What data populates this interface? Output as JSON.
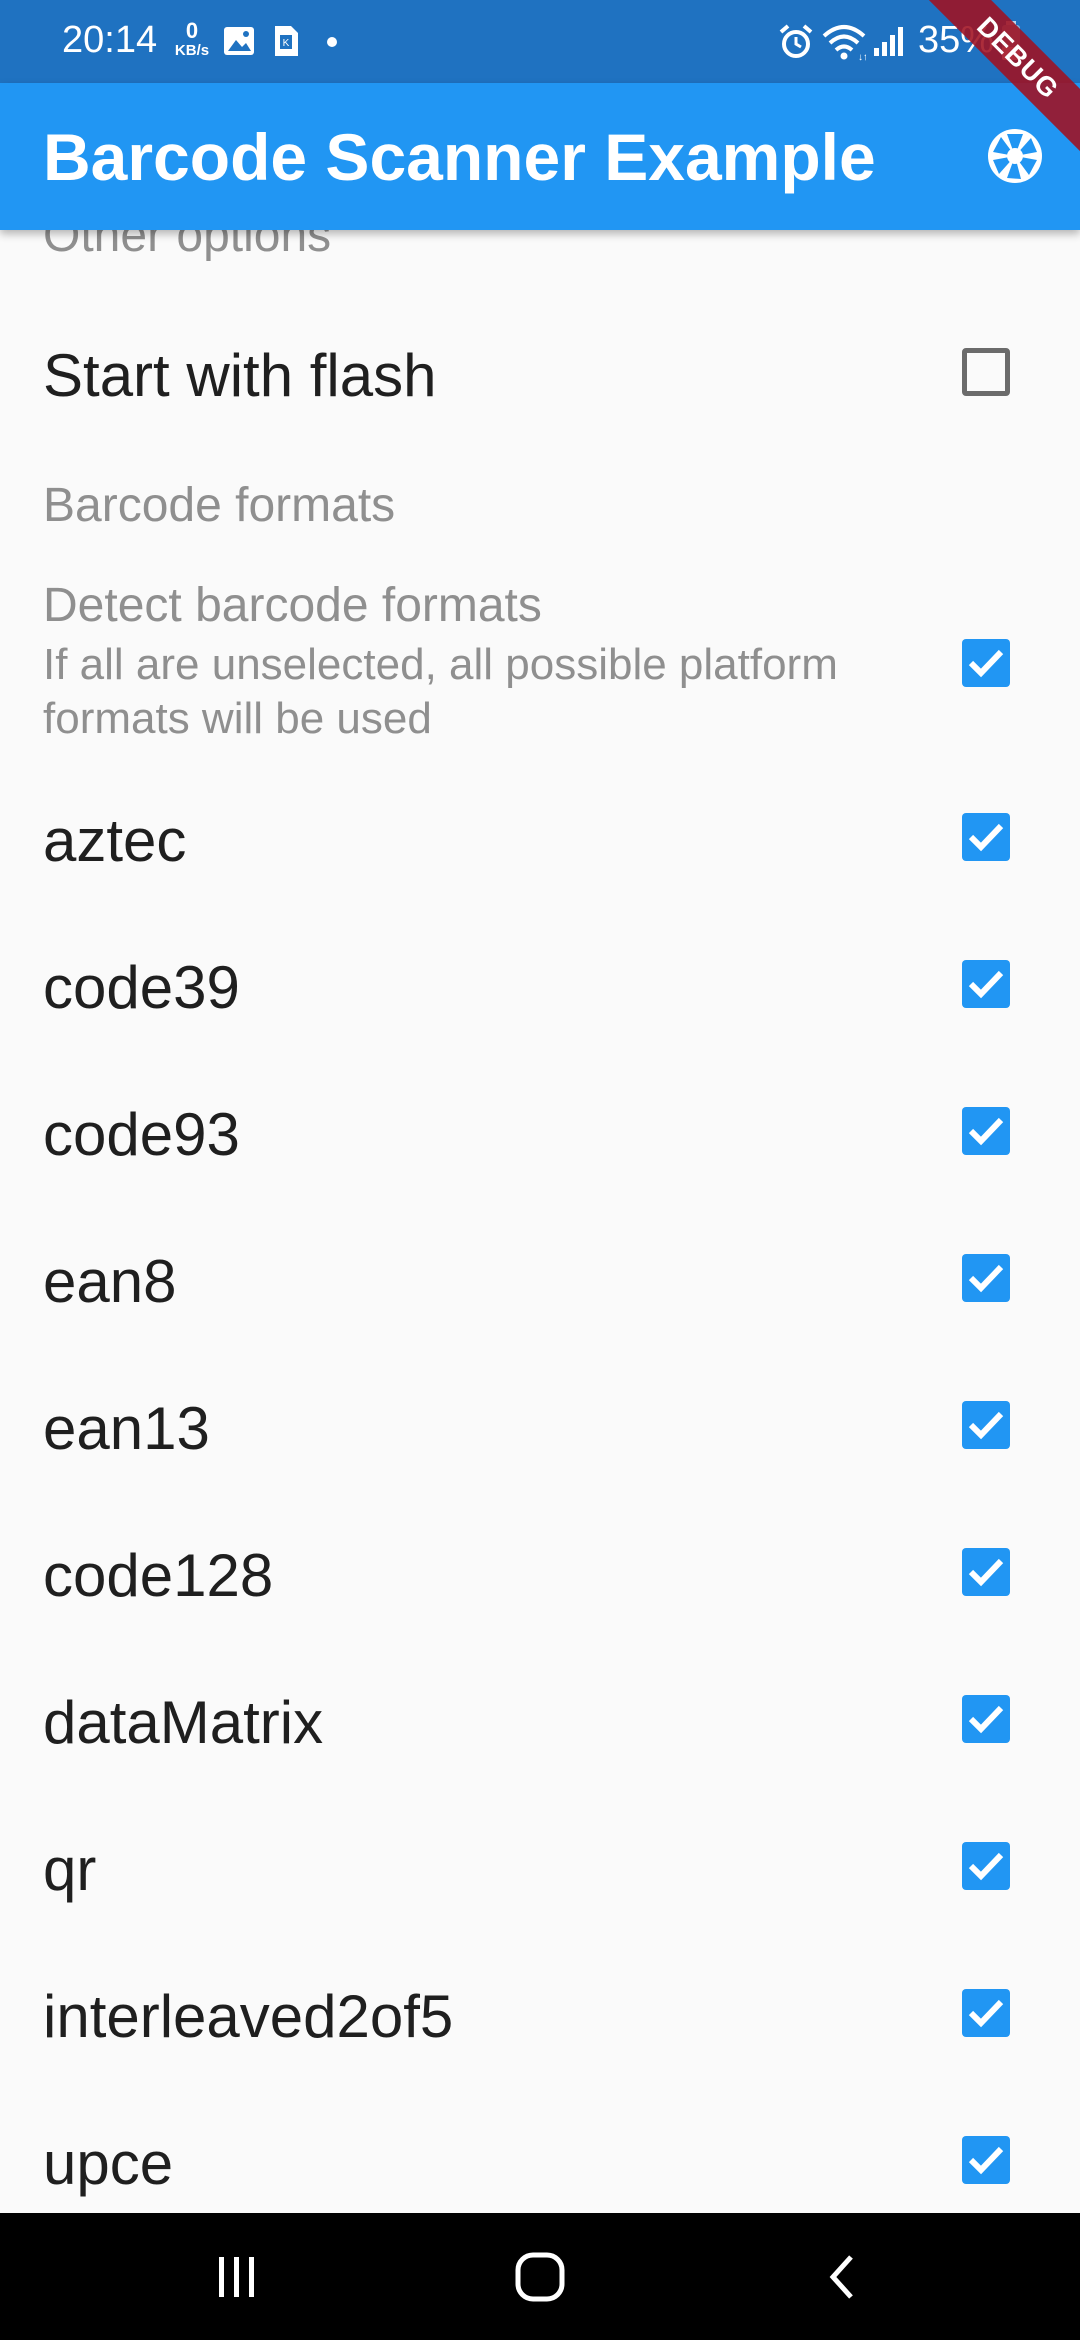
{
  "status_bar": {
    "time": "20:14",
    "net_speed_value": "0",
    "net_speed_unit": "KB/s",
    "battery_percent": "35%",
    "icons": [
      "image-icon",
      "sim-card-icon",
      "dot-icon",
      "alarm-icon",
      "wifi-icon",
      "signal-icon",
      "battery-icon"
    ]
  },
  "app_bar": {
    "title": "Barcode Scanner Example",
    "action_icon": "camera-shutter-icon",
    "background": "#2196f3"
  },
  "debug_banner": {
    "label": "DEBUG"
  },
  "settings": {
    "other_options_header": "Other options",
    "start_with_flash": {
      "label": "Start with flash",
      "checked": false
    },
    "barcode_formats_header": "Barcode formats",
    "detect_formats": {
      "title": "Detect barcode formats",
      "subtitle": "If all are unselected, all possible platform formats will be used",
      "checked": true
    },
    "formats": [
      {
        "label": "aztec",
        "checked": true
      },
      {
        "label": "code39",
        "checked": true
      },
      {
        "label": "code93",
        "checked": true
      },
      {
        "label": "ean8",
        "checked": true
      },
      {
        "label": "ean13",
        "checked": true
      },
      {
        "label": "code128",
        "checked": true
      },
      {
        "label": "dataMatrix",
        "checked": true
      },
      {
        "label": "qr",
        "checked": true
      },
      {
        "label": "interleaved2of5",
        "checked": true
      },
      {
        "label": "upce",
        "checked": true
      }
    ],
    "accent_color": "#2196f3"
  },
  "nav_bar": {
    "buttons": [
      "recent-apps-icon",
      "home-icon",
      "back-icon"
    ]
  }
}
